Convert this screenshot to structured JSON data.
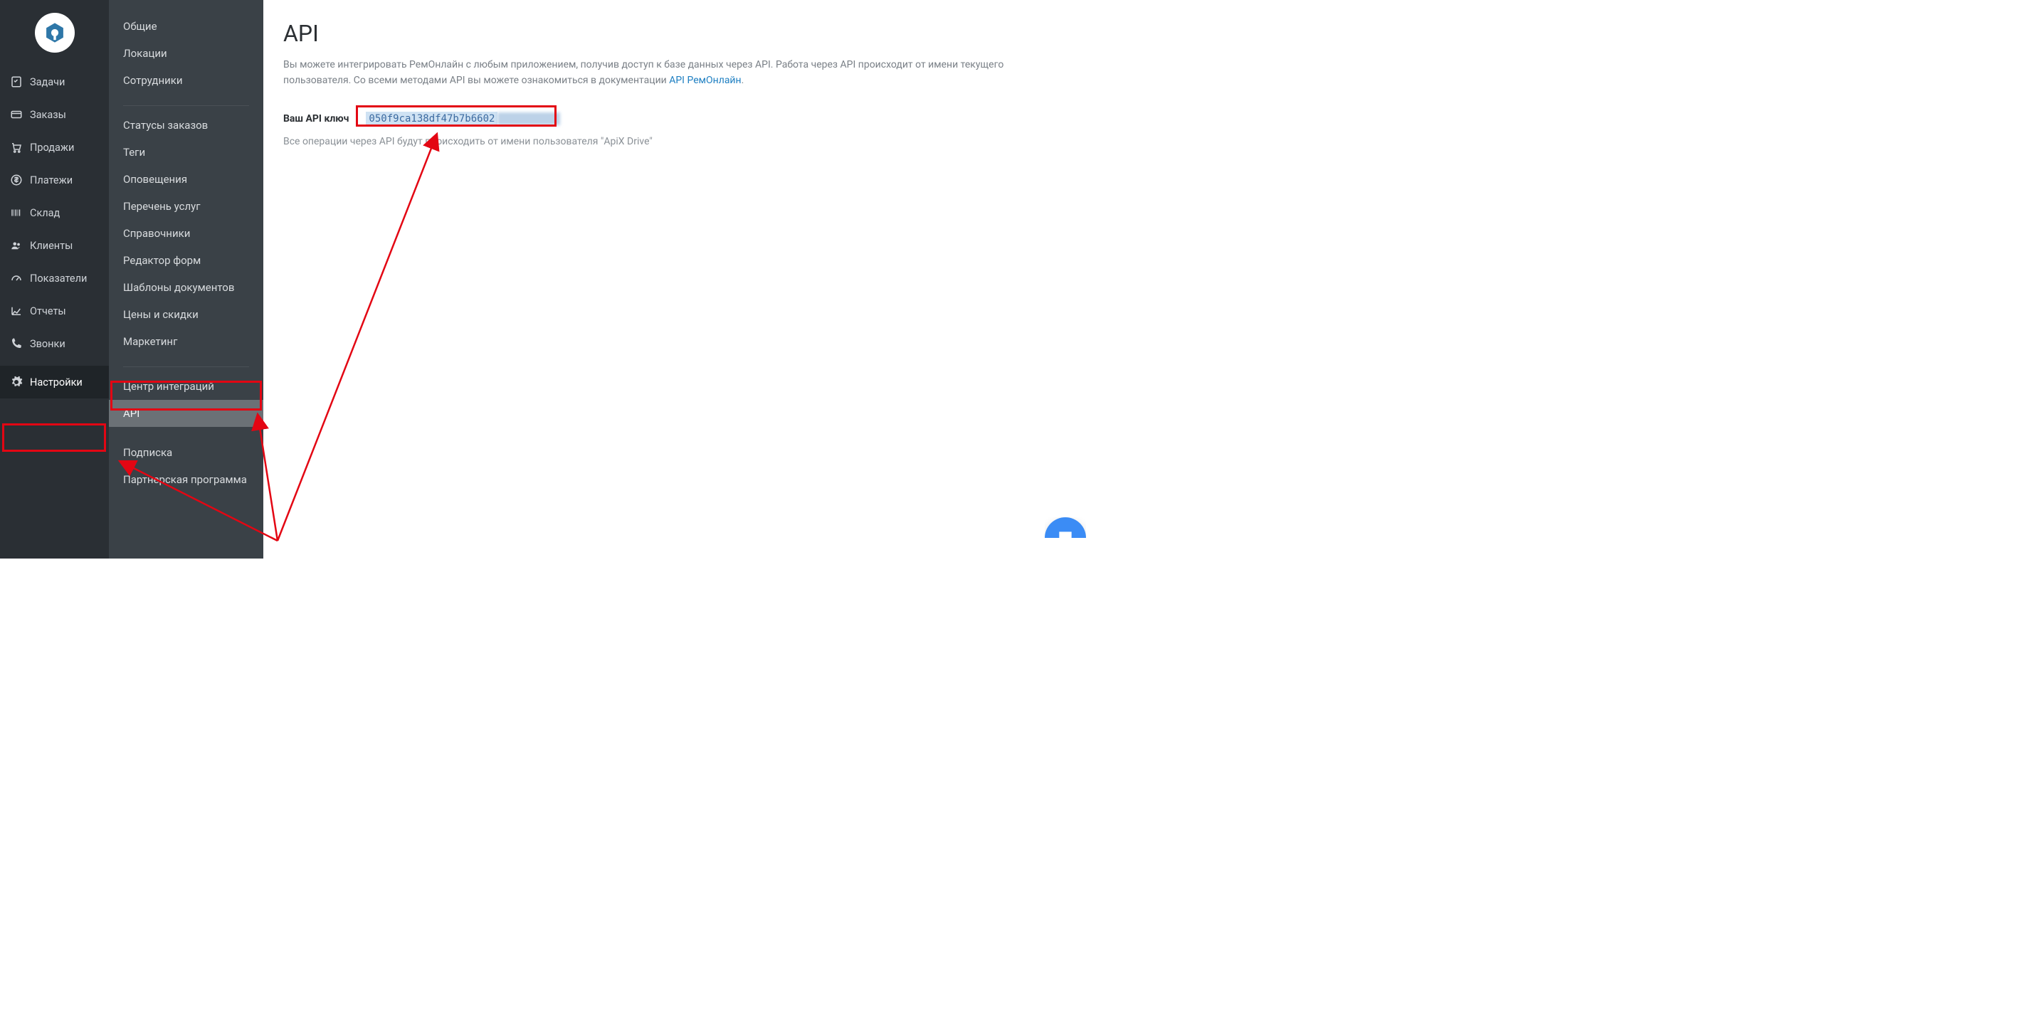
{
  "sidebar": {
    "items": [
      {
        "label": "Задачи",
        "icon": "checklist-icon"
      },
      {
        "label": "Заказы",
        "icon": "orders-icon"
      },
      {
        "label": "Продажи",
        "icon": "cart-icon"
      },
      {
        "label": "Платежи",
        "icon": "dollar-icon"
      },
      {
        "label": "Склад",
        "icon": "barcode-icon"
      },
      {
        "label": "Клиенты",
        "icon": "people-icon"
      },
      {
        "label": "Показатели",
        "icon": "gauge-icon"
      },
      {
        "label": "Отчеты",
        "icon": "chart-icon"
      },
      {
        "label": "Звонки",
        "icon": "phone-icon"
      },
      {
        "label": "Настройки",
        "icon": "gear-icon",
        "active": true
      }
    ]
  },
  "settingsMenu": {
    "group1": [
      "Общие",
      "Локации",
      "Сотрудники"
    ],
    "group2": [
      "Статусы заказов",
      "Теги",
      "Оповещения",
      "Перечень услуг",
      "Справочники",
      "Редактор форм",
      "Шаблоны документов",
      "Цены и скидки",
      "Маркетинг"
    ],
    "group3": [
      "Центр интеграций",
      "API"
    ],
    "group4": [
      "Подписка",
      "Партнерская программа"
    ],
    "selected": "API"
  },
  "page": {
    "title": "API",
    "intro_prefix": "Вы можете интегрировать РемОнлайн с любым приложением, получив доступ к базе данных через API. Работа через API происходит от имени текущего пользователя. Со всеми методами API вы можете ознакомиться в документации ",
    "intro_link": "API РемОнлайн",
    "intro_suffix": ".",
    "key_label": "Ваш API ключ",
    "key_value": "050f9ca138df47b7b6602",
    "note": "Все операции через API будут происходить от имени пользователя \"ApiX Drive\""
  },
  "colors": {
    "accent_red": "#e30613",
    "link_blue": "#1e7fc2"
  }
}
